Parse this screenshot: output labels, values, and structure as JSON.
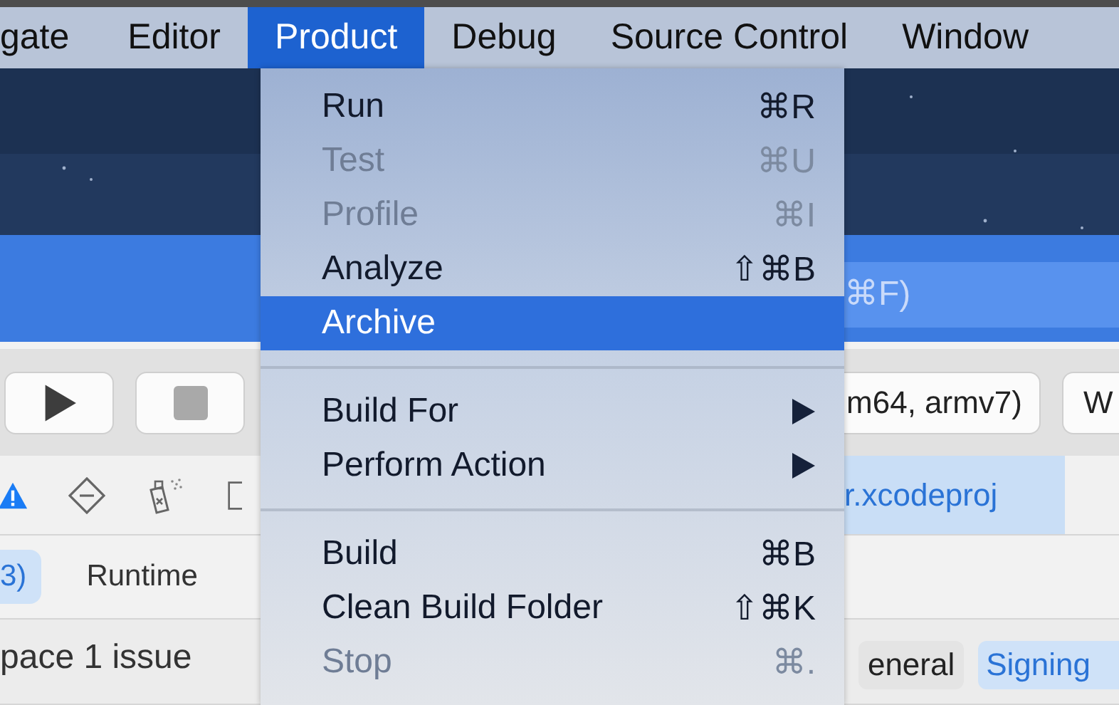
{
  "menu_bar": [
    {
      "label": "gate",
      "selected": false
    },
    {
      "label": "Editor",
      "selected": false
    },
    {
      "label": "Product",
      "selected": true
    },
    {
      "label": "Debug",
      "selected": false
    },
    {
      "label": "Source Control",
      "selected": false
    },
    {
      "label": "Window",
      "selected": false
    }
  ],
  "search_hint": "⌘F)",
  "toolbar": {
    "scheme": "m64, armv7)",
    "destination": "W"
  },
  "project_tab": "r.xcodeproj",
  "filter_tabs": [
    {
      "label": "3)",
      "selected": true
    },
    {
      "label": "Runtime",
      "selected": false
    }
  ],
  "issue_summary": "pace 1 issue",
  "editor_tabs": [
    {
      "label": "eneral",
      "selected": false
    },
    {
      "label": "Signing",
      "selected": true
    }
  ],
  "menu": {
    "items": [
      {
        "kind": "item",
        "label": "Run",
        "shortcut": "⌘R",
        "disabled": false,
        "selected": false
      },
      {
        "kind": "item",
        "label": "Test",
        "shortcut": "⌘U",
        "disabled": true,
        "selected": false
      },
      {
        "kind": "item",
        "label": "Profile",
        "shortcut": "⌘I",
        "disabled": true,
        "selected": false
      },
      {
        "kind": "item",
        "label": "Analyze",
        "shortcut": "⇧⌘B",
        "disabled": false,
        "selected": false
      },
      {
        "kind": "item",
        "label": "Archive",
        "disabled": false,
        "selected": true
      },
      {
        "kind": "separator"
      },
      {
        "kind": "submenu",
        "label": "Build For",
        "disabled": false,
        "selected": false
      },
      {
        "kind": "submenu",
        "label": "Perform Action",
        "disabled": false,
        "selected": false
      },
      {
        "kind": "separator"
      },
      {
        "kind": "item",
        "label": "Build",
        "shortcut": "⌘B",
        "disabled": false,
        "selected": false
      },
      {
        "kind": "item",
        "label": "Clean Build Folder",
        "shortcut": "⇧⌘K",
        "disabled": false,
        "selected": false
      },
      {
        "kind": "item",
        "label": "Stop",
        "shortcut": "⌘.",
        "disabled": true,
        "selected": false
      }
    ]
  }
}
